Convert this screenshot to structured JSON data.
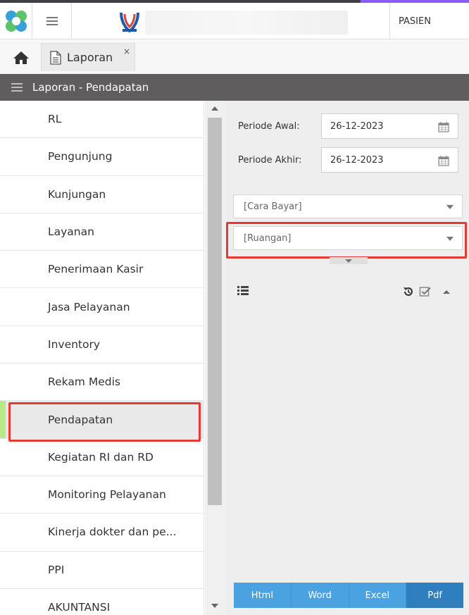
{
  "topbar": {
    "user_menu_label": "PASIEN"
  },
  "tabs": {
    "active_tab_label": "Laporan",
    "close_glyph": "×"
  },
  "section": {
    "title": "Laporan - Pendapatan"
  },
  "menu": {
    "items": [
      {
        "label": "RL"
      },
      {
        "label": "Pengunjung"
      },
      {
        "label": "Kunjungan"
      },
      {
        "label": "Layanan"
      },
      {
        "label": "Penerimaan Kasir"
      },
      {
        "label": "Jasa Pelayanan"
      },
      {
        "label": "Inventory"
      },
      {
        "label": "Rekam Medis"
      },
      {
        "label": "Pendapatan"
      },
      {
        "label": "Kegiatan RI dan RD"
      },
      {
        "label": "Monitoring Pelayanan"
      },
      {
        "label": "Kinerja dokter dan pe..."
      },
      {
        "label": "PPI"
      },
      {
        "label": "AKUNTANSI"
      }
    ],
    "active_index": 8
  },
  "filters": {
    "periode_awal_label": "Periode Awal:",
    "periode_awal_value": "26-12-2023",
    "periode_akhir_label": "Periode Akhir:",
    "periode_akhir_value": "26-12-2023",
    "cara_bayar_placeholder": "[Cara Bayar]",
    "ruangan_placeholder": "[Ruangan]"
  },
  "export": {
    "html": "Html",
    "word": "Word",
    "excel": "Excel",
    "pdf": "Pdf"
  },
  "icons": {
    "app_logo": "app-logo-icon",
    "menu": "hamburger-icon",
    "home": "home-icon",
    "document": "document-icon",
    "calendar": "calendar-icon",
    "list": "list-icon",
    "refresh": "history-icon",
    "checkbox": "check-square-icon"
  },
  "colors": {
    "header_bg": "#5f5d5d",
    "active_indicator": "#b8e986",
    "highlight": "#e53935",
    "export_btn": "#4aa3e0",
    "export_pdf": "#2f7fbf"
  }
}
